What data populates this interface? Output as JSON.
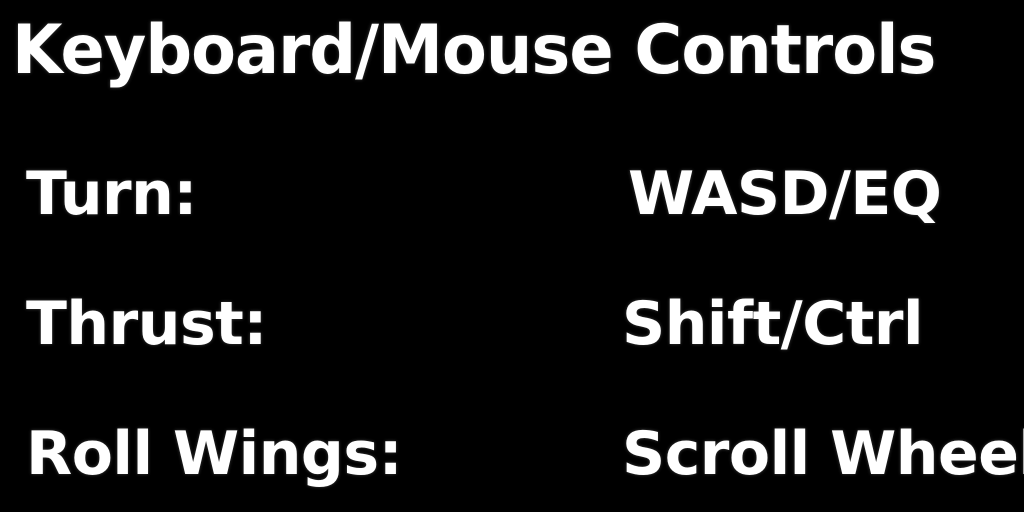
{
  "screen": {
    "title": "Keyboard/Mouse Controls",
    "background": "#000000",
    "text_color": "#ffffff"
  },
  "controls": [
    {
      "label": "Turn:",
      "keys": "WASD/EQ"
    },
    {
      "label": "Thrust:",
      "keys": "Shift/Ctrl"
    },
    {
      "label": "Roll Wings:",
      "keys": "Scroll Wheel"
    }
  ]
}
